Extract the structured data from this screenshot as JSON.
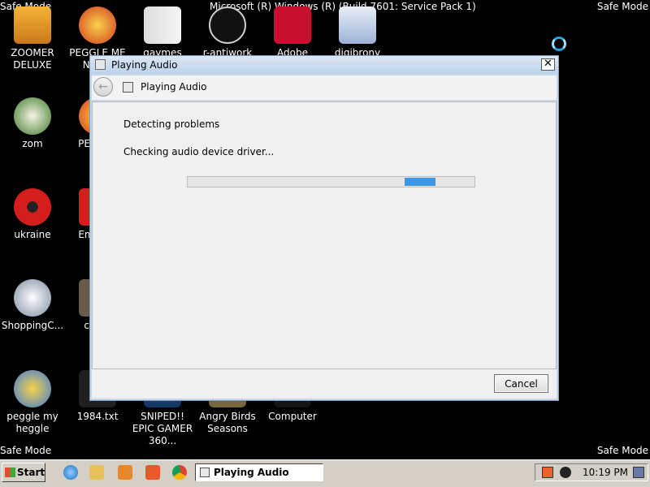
{
  "desktop": {
    "safe_mode": "Safe Mode",
    "build_text": "Microsoft (R) Windows (R) (Build 7601: Service Pack 1)",
    "icons": [
      {
        "label": "ZOOMER DELUXE"
      },
      {
        "label": "PEGGLE ME NEC..."
      },
      {
        "label": "gaymes"
      },
      {
        "label": "r-antiwork"
      },
      {
        "label": "Adobe Reader"
      },
      {
        "label": "digibrony"
      },
      {
        "label": "zom"
      },
      {
        "label": "PEG MO"
      },
      {
        "label": "ukraine"
      },
      {
        "label": "Emb De"
      },
      {
        "label": "ShoppingC..."
      },
      {
        "label": "chom"
      },
      {
        "label": "peggle my heggle"
      },
      {
        "label": "1984.txt"
      },
      {
        "label": "SNIPED!! EPIC GAMER 360..."
      },
      {
        "label": "Angry Birds Seasons"
      },
      {
        "label": "Computer"
      }
    ]
  },
  "dialog": {
    "title": "Playing Audio",
    "nav_title": "Playing Audio",
    "close_glyph": "✕",
    "back_glyph": "←",
    "status_heading": "Detecting problems",
    "status_detail": "Checking audio device driver...",
    "progress": {
      "start": 0.755,
      "end": 0.865
    },
    "cancel_label": "Cancel"
  },
  "taskbar": {
    "start_label": "Start",
    "active_task": "Playing Audio",
    "clock": "10:19 PM"
  },
  "colors": {
    "progress_fill": "#3d95e6",
    "desktop_bg": "#000000",
    "taskbar_bg": "#d4d0c8"
  }
}
